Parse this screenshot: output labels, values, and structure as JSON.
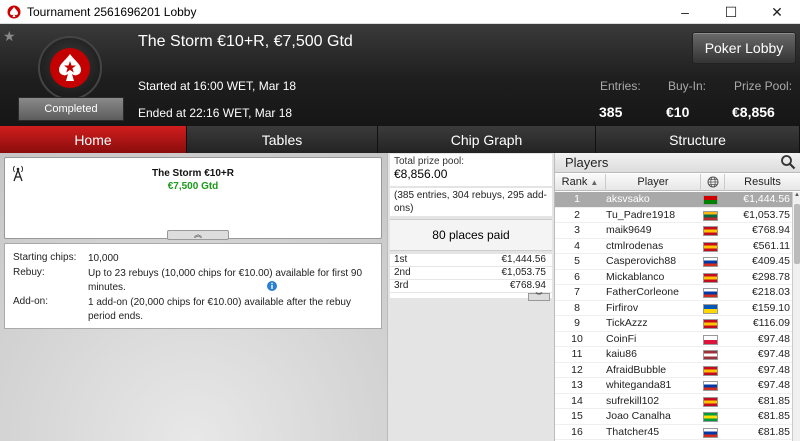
{
  "window": {
    "title": "Tournament 2561696201 Lobby",
    "controls": [
      "–",
      "☐",
      "✕"
    ]
  },
  "header": {
    "tournament_name": "The Storm €10+R, €7,500 Gtd",
    "status": "Completed",
    "started": "Started at 16:00 WET, Mar 18",
    "ended": "Ended at 22:16 WET, Mar 18",
    "entries_label": "Entries:",
    "entries_value": "385",
    "buyin_label": "Buy-In:",
    "buyin_value": "€10",
    "prizepool_label": "Prize Pool:",
    "prizepool_value": "€8,856",
    "lobby_button": "Poker Lobby"
  },
  "tabs": [
    {
      "label": "Home",
      "active": true
    },
    {
      "label": "Tables",
      "active": false
    },
    {
      "label": "Chip Graph",
      "active": false
    },
    {
      "label": "Structure",
      "active": false
    }
  ],
  "banner": {
    "name": "The Storm €10+R",
    "prize": "€7,500 Gtd"
  },
  "info": {
    "starting_chips_label": "Starting chips:",
    "starting_chips_value": "10,000",
    "rebuy_label": "Rebuy:",
    "rebuy_value": "Up to 23 rebuys (10,000 chips for €10.00) available for first 90 minutes.",
    "addon_label": "Add-on:",
    "addon_value": "1 add-on (20,000 chips for €10.00) available after the rebuy period ends."
  },
  "prize": {
    "total_label": "Total prize pool:",
    "total_value": "€8,856.00",
    "detail": "(385 entries, 304 rebuys, 295 add-ons)",
    "places_paid": "80 places paid",
    "payouts": [
      {
        "place": "1st",
        "amount": "€1,444.56"
      },
      {
        "place": "2nd",
        "amount": "€1,053.75"
      },
      {
        "place": "3rd",
        "amount": "€768.94"
      }
    ]
  },
  "players": {
    "title": "Players",
    "col_rank": "Rank",
    "col_player": "Player",
    "col_results": "Results",
    "rows": [
      {
        "rank": "1",
        "name": "aksvsako",
        "flag": [
          "#d00000",
          "#008000"
        ],
        "result": "€1,444.56"
      },
      {
        "rank": "2",
        "name": "Tu_Padre1918",
        "flag": [
          "#fdb913",
          "#006a44",
          "#c1272d"
        ],
        "result": "€1,053.75"
      },
      {
        "rank": "3",
        "name": "maik9649",
        "flag": [
          "#c60b1e",
          "#ffc400",
          "#c60b1e"
        ],
        "result": "€768.94"
      },
      {
        "rank": "4",
        "name": "ctmlrodenas",
        "flag": [
          "#c60b1e",
          "#ffc400",
          "#c60b1e"
        ],
        "result": "€561.11"
      },
      {
        "rank": "5",
        "name": "Casperovich88",
        "flag": [
          "#ffffff",
          "#0039a6",
          "#d52b1e"
        ],
        "result": "€409.45"
      },
      {
        "rank": "6",
        "name": "Mickablanco",
        "flag": [
          "#c60b1e",
          "#ffc400",
          "#c60b1e"
        ],
        "result": "€298.78"
      },
      {
        "rank": "7",
        "name": "FatherCorleone",
        "flag": [
          "#ffffff",
          "#0039a6",
          "#d52b1e"
        ],
        "result": "€218.03"
      },
      {
        "rank": "8",
        "name": "Firfirov",
        "flag": [
          "#0057b7",
          "#ffd700"
        ],
        "result": "€159.10"
      },
      {
        "rank": "9",
        "name": "TickAzzz",
        "flag": [
          "#c60b1e",
          "#ffc400",
          "#c60b1e"
        ],
        "result": "€116.09"
      },
      {
        "rank": "10",
        "name": "CoinFi",
        "flag": [
          "#ffffff",
          "#dc143c"
        ],
        "result": "€97.48"
      },
      {
        "rank": "11",
        "name": "kaiu86",
        "flag": [
          "#9e3039",
          "#ffffff",
          "#9e3039"
        ],
        "result": "€97.48"
      },
      {
        "rank": "12",
        "name": "AfraidBubble",
        "flag": [
          "#c60b1e",
          "#ffc400",
          "#c60b1e"
        ],
        "result": "€97.48"
      },
      {
        "rank": "13",
        "name": "whiteganda81",
        "flag": [
          "#ffffff",
          "#0039a6",
          "#d52b1e"
        ],
        "result": "€97.48"
      },
      {
        "rank": "14",
        "name": "sufrekill102",
        "flag": [
          "#c60b1e",
          "#ffc400",
          "#c60b1e"
        ],
        "result": "€81.85"
      },
      {
        "rank": "15",
        "name": "Joao Canalha",
        "flag": [
          "#009c3b",
          "#ffdf00",
          "#009c3b"
        ],
        "result": "€81.85"
      },
      {
        "rank": "16",
        "name": "Thatcher45",
        "flag": [
          "#ffffff",
          "#0039a6",
          "#d52b1e"
        ],
        "result": "€81.85"
      }
    ]
  },
  "icons": {
    "app": "pokerstars-icon",
    "favorite": "star-icon",
    "signal": "antenna-icon",
    "search": "magnifier-icon",
    "globe": "globe-icon"
  }
}
